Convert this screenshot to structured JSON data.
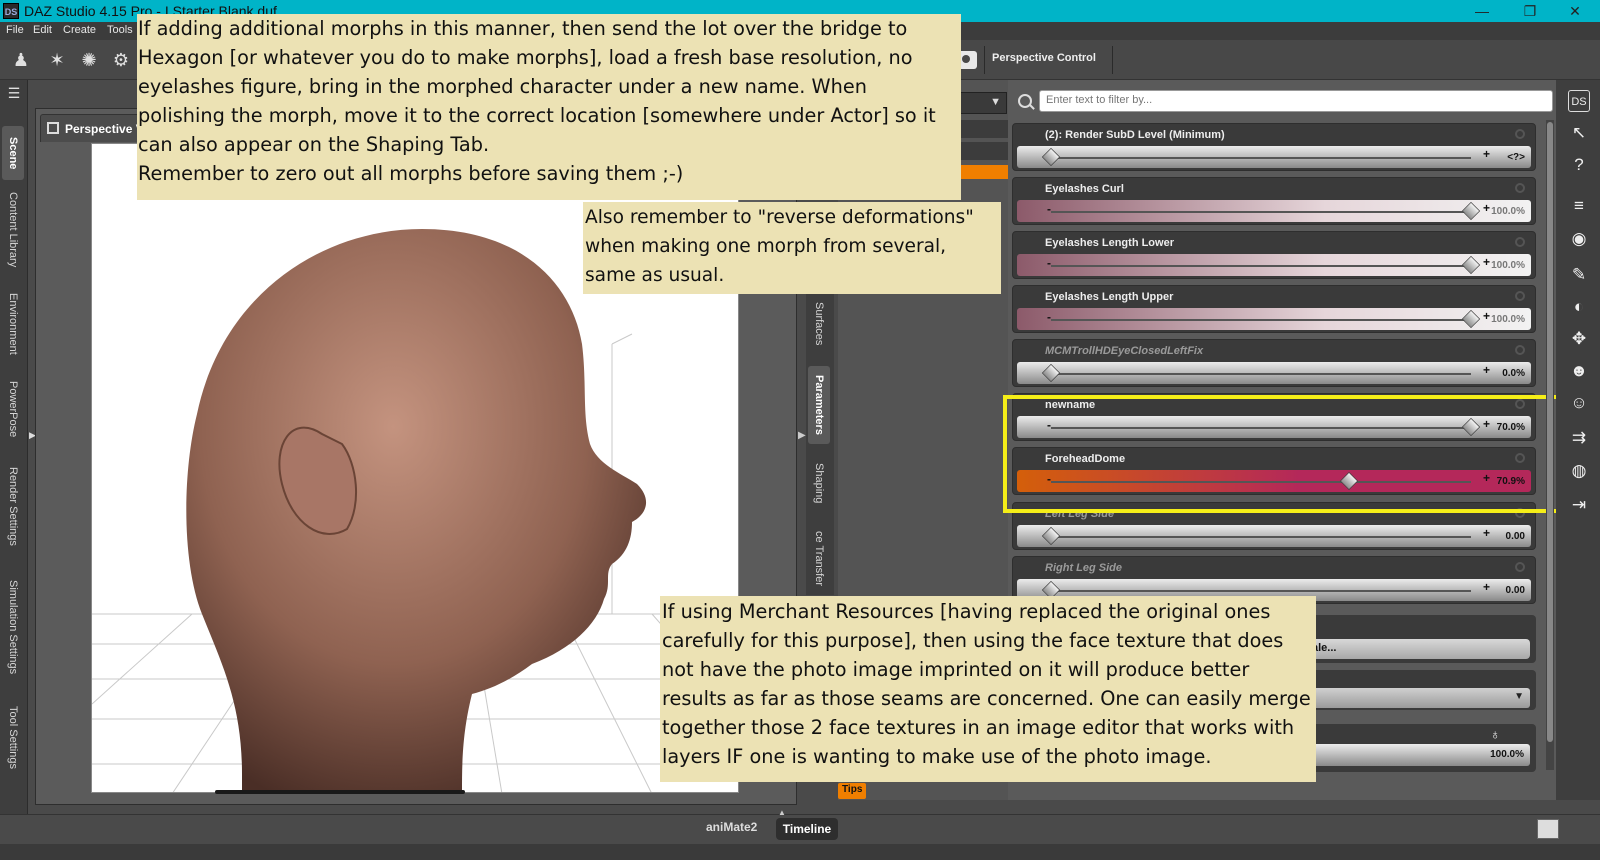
{
  "window": {
    "title": "DAZ Studio 4.15 Pro - I Starter Blank.duf",
    "app_icon": "DS",
    "minimize": "—",
    "maximize": "❐",
    "close": "✕"
  },
  "menu": [
    "File",
    "Edit",
    "Create",
    "Tools"
  ],
  "toolbar": {
    "perspective_control": "Perspective Control"
  },
  "left_tabs": [
    "Scene",
    "Content Library",
    "Environment",
    "PowerPose",
    "Render Settings",
    "Simulation Settings",
    "Tool Settings"
  ],
  "viewport": {
    "tab_label": "Perspective V"
  },
  "mid_tabs": [
    "Surfaces",
    "Parameters",
    "Shaping",
    "ce Transfer"
  ],
  "search": {
    "placeholder": "Enter text to filter by..."
  },
  "parameters": [
    {
      "name": "(2): Render SubD Level (Minimum)",
      "value": "<?>",
      "level": 0.0,
      "style": "gray",
      "disabled": false
    },
    {
      "name": "Eyelashes Curl",
      "value": "100.0%",
      "level": 1.0,
      "style": "pink",
      "disabled": false
    },
    {
      "name": "Eyelashes Length Lower",
      "value": "100.0%",
      "level": 1.0,
      "style": "pink",
      "disabled": false
    },
    {
      "name": "Eyelashes Length Upper",
      "value": "100.0%",
      "level": 1.0,
      "style": "pink",
      "disabled": false
    },
    {
      "name": "MCMTrollHDEyeClosedLeftFix",
      "value": "0.0%",
      "level": 0.0,
      "style": "gray",
      "disabled": true
    },
    {
      "name": "newname",
      "value": "70.0%",
      "level": 1.0,
      "style": "gray",
      "disabled": false
    },
    {
      "name": "ForeheadDome",
      "value": "70.9%",
      "level": 0.709,
      "style": "orange",
      "disabled": false
    },
    {
      "name": "Left Leg Side",
      "value": "0.00",
      "level": 0.0,
      "style": "gray",
      "disabled": true
    },
    {
      "name": "Right Leg Side",
      "value": "0.00",
      "level": 0.0,
      "style": "gray",
      "disabled": true
    }
  ],
  "partial_rows": {
    "scale_label": "ale...",
    "last_value": "100.0%"
  },
  "tips": "Tips",
  "bottom_tabs": {
    "animate": "aniMate2",
    "timeline": "Timeline"
  },
  "notes": {
    "note1": "If adding additional morphs in this manner, then send the lot over the bridge to\nHexagon [or whatever you do to make morphs], load a fresh base resolution, no\neyelashes figure, bring in the morphed character under a new name. When\npolishing the morph, move it to the correct location [somewhere under Actor] so it\ncan also appear on the Shaping Tab.\nRemember to zero out all morphs before saving them ;-)",
    "note2": "Also remember to \"reverse deformations\"\nwhen making one morph from several,\nsame as usual.",
    "note3": "If using Merchant Resources [having replaced the original ones\ncarefully for this purpose], then using the face texture that does\nnot have the photo image imprinted on it will produce better\nresults as far as those seams are concerned. One can easily merge\ntogether those 2 face textures in an image editor that works with\nlayers IF one is wanting to make use of the photo image."
  },
  "colors": {
    "accent_orange": "#f07f00",
    "highlight_yellow": "#f5ee18",
    "titlebar": "#00b4c8",
    "note_bg": "#ece2b4"
  }
}
